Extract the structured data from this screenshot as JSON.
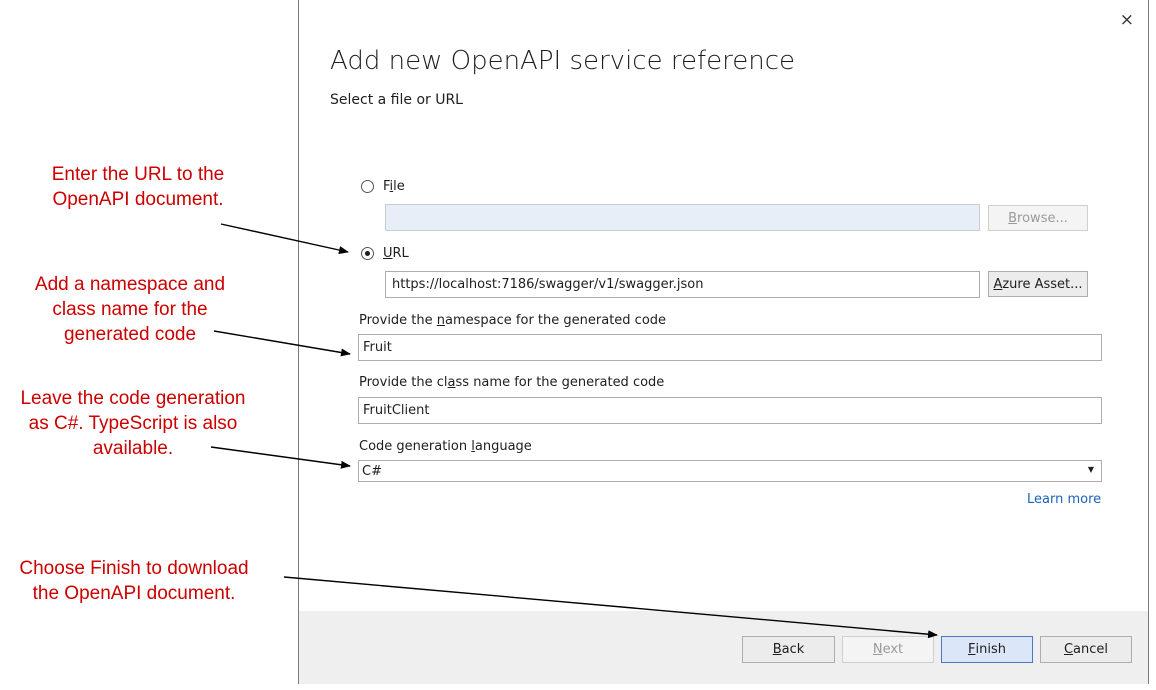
{
  "dialog": {
    "close_glyph": "×",
    "title": "Add new OpenAPI service reference",
    "subtitle": "Select a file or URL",
    "file_option": {
      "prefix": "F",
      "accel": "i",
      "rest": "le",
      "selected": false
    },
    "file_path": "",
    "browse_button": {
      "prefix": "",
      "accel": "B",
      "rest": "rowse..."
    },
    "url_option": {
      "prefix": "",
      "accel": "U",
      "rest": "RL",
      "selected": true
    },
    "url_value": "https://localhost:7186/swagger/v1/swagger.json",
    "azure_button": {
      "prefix": "",
      "accel": "A",
      "rest": "zure Asset..."
    },
    "namespace_label": {
      "prefix": "Provide the ",
      "accel": "n",
      "rest": "amespace for the generated code"
    },
    "namespace_value": "Fruit",
    "classname_label": {
      "prefix": "Provide the cl",
      "accel": "a",
      "rest": "ss name for the generated code"
    },
    "classname_value": "FruitClient",
    "language_label": {
      "prefix": "Code generation ",
      "accel": "l",
      "rest": "anguage"
    },
    "language_value": "C#",
    "learn_more": "Learn more"
  },
  "footer": {
    "back_button": {
      "prefix": "",
      "accel": "B",
      "rest": "ack"
    },
    "next_button": {
      "prefix": "",
      "accel": "N",
      "rest": "ext"
    },
    "finish_button": {
      "prefix": "",
      "accel": "F",
      "rest": "inish"
    },
    "cancel_button": {
      "prefix": "",
      "accel": "C",
      "rest": "ancel"
    }
  },
  "annotations": [
    {
      "line1": "Enter the URL to the",
      "line2": "OpenAPI document."
    },
    {
      "line1": "Add a namespace and",
      "line2": "class name for the",
      "line3": "generated code"
    },
    {
      "line1": "Leave the code generation",
      "line2": "as C#. TypeScript is also",
      "line3": "available."
    },
    {
      "line1": "Choose Finish to download",
      "line2": "the OpenAPI document."
    }
  ],
  "colors": {
    "annotation_red": "#cc0000",
    "link_blue": "#1a62b8",
    "primary_button": "#dbe6f9",
    "footer_gray": "#efefef"
  }
}
